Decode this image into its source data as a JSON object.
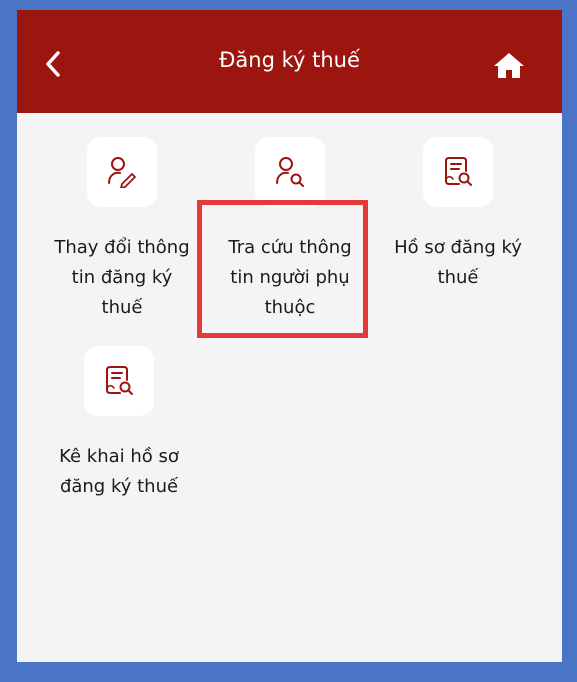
{
  "header": {
    "title": "Đăng ký thuế",
    "back_icon": "chevron-left-icon",
    "home_icon": "home-icon"
  },
  "tiles": [
    {
      "label": "Thay đổi thông\ntin đăng ký\nthuế",
      "icon": "user-edit-icon"
    },
    {
      "label": "Tra cứu thông\ntin người phụ\nthuộc",
      "icon": "user-search-icon"
    },
    {
      "label": "Hồ sơ đăng ký\nthuế",
      "icon": "document-search-icon"
    },
    {
      "label": "Kê khai hồ sơ\nđăng ký thuế",
      "icon": "document-search-icon"
    }
  ],
  "colors": {
    "header": "#9c150f",
    "icon": "#9c150f",
    "highlight": "#e43a3a",
    "frame": "#4a74c6"
  }
}
